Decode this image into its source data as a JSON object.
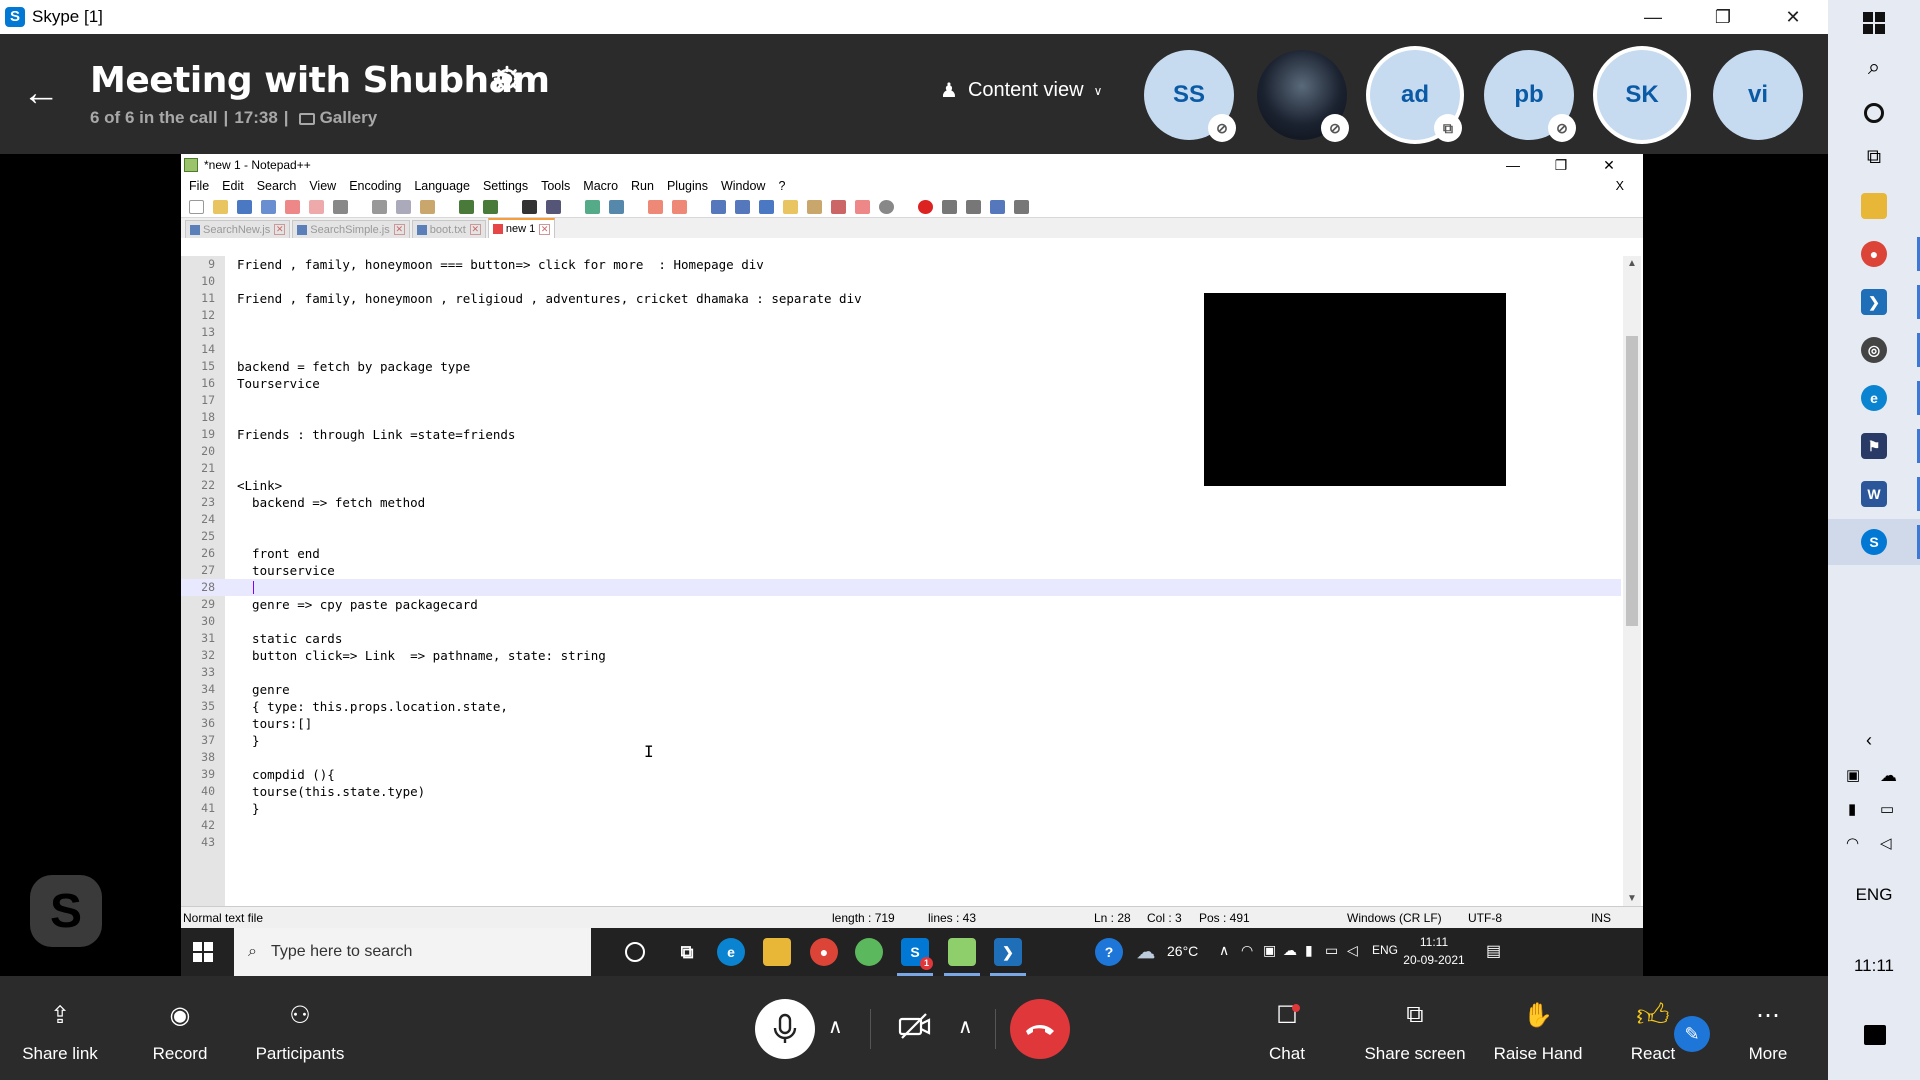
{
  "skype_window": {
    "title": "Skype [1]",
    "minimize": "—",
    "restore": "❐",
    "close": "✕"
  },
  "call": {
    "title": "Meeting with Shubham",
    "participants_status": "6 of 6 in the call",
    "duration": "17:38",
    "view_mode": "Gallery",
    "content_view_label": "Content view",
    "participants": [
      {
        "initials": "SS",
        "muted": true
      },
      {
        "initials": "",
        "muted": true
      },
      {
        "initials": "ad",
        "muted": false
      },
      {
        "initials": "pb",
        "muted": true
      },
      {
        "initials": "SK",
        "muted": false
      },
      {
        "initials": "vi",
        "muted": false
      }
    ]
  },
  "notepad": {
    "title": "*new 1 - Notepad++",
    "menu": [
      "File",
      "Edit",
      "Search",
      "View",
      "Encoding",
      "Language",
      "Settings",
      "Tools",
      "Macro",
      "Run",
      "Plugins",
      "Window",
      "?"
    ],
    "close_doc": "X",
    "tabs": [
      {
        "label": "SearchNew.js",
        "active": false
      },
      {
        "label": "SearchSimple.js",
        "active": false
      },
      {
        "label": "boot.txt",
        "active": false
      },
      {
        "label": "new 1",
        "active": true
      }
    ],
    "lines": [
      {
        "n": "9",
        "text": "Friend , family, honeymoon === button=> click for more  : Homepage div"
      },
      {
        "n": "10",
        "text": ""
      },
      {
        "n": "11",
        "text": "Friend , family, honeymoon , religioud , adventures, cricket dhamaka : separate div"
      },
      {
        "n": "12",
        "text": ""
      },
      {
        "n": "13",
        "text": ""
      },
      {
        "n": "14",
        "text": ""
      },
      {
        "n": "15",
        "text": "backend = fetch by package type"
      },
      {
        "n": "16",
        "text": "Tourservice"
      },
      {
        "n": "17",
        "text": ""
      },
      {
        "n": "18",
        "text": ""
      },
      {
        "n": "19",
        "text": "Friends : through Link =state=friends"
      },
      {
        "n": "20",
        "text": ""
      },
      {
        "n": "21",
        "text": ""
      },
      {
        "n": "22",
        "text": "<Link>"
      },
      {
        "n": "23",
        "text": "  backend => fetch method"
      },
      {
        "n": "24",
        "text": ""
      },
      {
        "n": "25",
        "text": ""
      },
      {
        "n": "26",
        "text": "  front end"
      },
      {
        "n": "27",
        "text": "  tourservice"
      },
      {
        "n": "28",
        "text": ""
      },
      {
        "n": "29",
        "text": "  genre => cpy paste packagecard"
      },
      {
        "n": "30",
        "text": ""
      },
      {
        "n": "31",
        "text": "  static cards"
      },
      {
        "n": "32",
        "text": "  button click=> Link  => pathname, state: string"
      },
      {
        "n": "33",
        "text": ""
      },
      {
        "n": "34",
        "text": "  genre"
      },
      {
        "n": "35",
        "text": "  { type: this.props.location.state,"
      },
      {
        "n": "36",
        "text": "  tours:[]"
      },
      {
        "n": "37",
        "text": "  }"
      },
      {
        "n": "38",
        "text": ""
      },
      {
        "n": "39",
        "text": "  compdid (){"
      },
      {
        "n": "40",
        "text": "  tourse(this.state.type)"
      },
      {
        "n": "41",
        "text": "  }"
      },
      {
        "n": "42",
        "text": ""
      },
      {
        "n": "43",
        "text": ""
      }
    ],
    "current_line": "28",
    "status": {
      "file_type": "Normal text file",
      "length": "length : 719",
      "lines": "lines : 43",
      "ln": "Ln : 28",
      "col": "Col : 3",
      "pos": "Pos : 491",
      "eol": "Windows (CR LF)",
      "encoding": "UTF-8",
      "mode": "INS"
    }
  },
  "inner_taskbar": {
    "search_placeholder": "Type here to search",
    "weather": "26°C",
    "lang": "ENG",
    "time": "11:11",
    "date": "20-09-2021",
    "skype_badge": "1"
  },
  "controls": {
    "share_link": "Share link",
    "record": "Record",
    "participants": "Participants",
    "chat": "Chat",
    "share_screen": "Share screen",
    "raise_hand": "Raise Hand",
    "react": "React",
    "more": "More"
  },
  "host_taskbar": {
    "lang": "ENG",
    "time": "11:11"
  },
  "colors": {
    "skype_dark": "#2b2b2b",
    "avatar_bg": "#c6daf0",
    "avatar_text": "#0a5aa5",
    "hangup": "#e0373b",
    "skype_blue": "#0078d4"
  }
}
